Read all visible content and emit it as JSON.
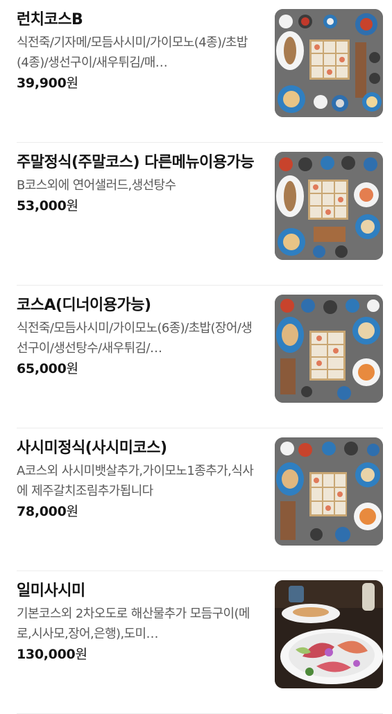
{
  "menu": {
    "currency_suffix": "원",
    "items": [
      {
        "name": "런치코스B",
        "description": "식전죽/기자메/모듬사시미/가이모노(4종)/초밥(4종)/생선구이/새우튀김/매…",
        "price": "39,900",
        "image": "course-spread-photo"
      },
      {
        "name": "주말정식(주말코스) 다른메뉴이용가능",
        "description": "B코스외에 연어샐러드,생선탕수",
        "price": "53,000",
        "image": "course-spread-photo"
      },
      {
        "name": "코스A(디너이용가능)",
        "description": "식전죽/모듬사시미/가이모노(6종)/초밥(장어/생선구이/생선탕수/새우튀김/…",
        "price": "65,000",
        "image": "course-spread-photo"
      },
      {
        "name": "사시미정식(사시미코스)",
        "description": "A코스외 사시미뱃살추가,가이모노1종추가,식사에 제주갈치조림추가됩니다",
        "price": "78,000",
        "image": "course-spread-photo"
      },
      {
        "name": "일미사시미",
        "description": "기본코스외 2차오도로 해산물추가 모듬구이(메로,시사모,장어,은행),도미…",
        "price": "130,000",
        "image": "sashimi-platter-photo"
      }
    ]
  }
}
